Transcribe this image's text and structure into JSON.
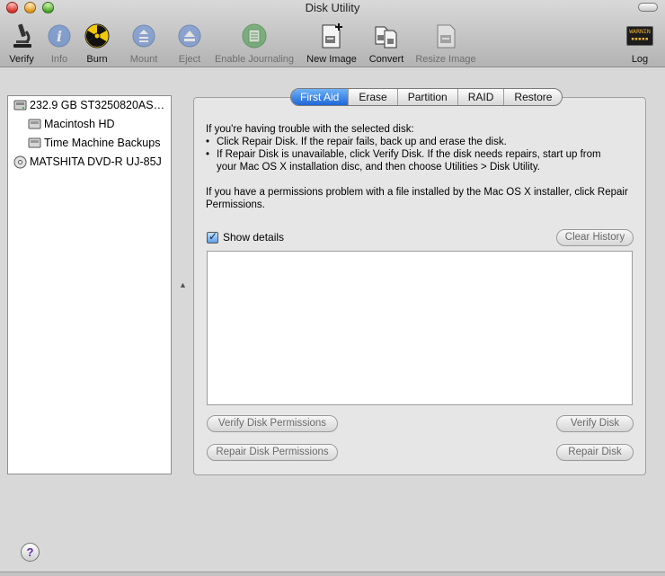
{
  "window": {
    "title": "Disk Utility"
  },
  "toolbar": {
    "items": [
      {
        "label": "Verify",
        "icon": "microscope-icon",
        "enabled": true
      },
      {
        "label": "Info",
        "icon": "info-icon",
        "enabled": false
      },
      {
        "label": "Burn",
        "icon": "burn-radiation-icon",
        "enabled": true
      },
      {
        "label": "Mount",
        "icon": "mount-icon",
        "enabled": false
      },
      {
        "label": "Eject",
        "icon": "eject-icon",
        "enabled": false
      },
      {
        "label": "Enable Journaling",
        "icon": "journaling-icon",
        "enabled": false
      },
      {
        "label": "New Image",
        "icon": "new-image-icon",
        "enabled": true
      },
      {
        "label": "Convert",
        "icon": "convert-icon",
        "enabled": true
      },
      {
        "label": "Resize Image",
        "icon": "resize-image-icon",
        "enabled": false
      },
      {
        "label": "Log",
        "icon": "log-console-icon",
        "enabled": true
      }
    ],
    "log_icon_text": "WARNIN"
  },
  "sidebar": {
    "items": [
      {
        "label": "232.9 GB ST3250820AS…",
        "icon": "hard-drive-icon",
        "indent": 0
      },
      {
        "label": "Macintosh HD",
        "icon": "volume-icon",
        "indent": 1
      },
      {
        "label": "Time Machine Backups",
        "icon": "volume-icon",
        "indent": 1
      },
      {
        "label": "MATSHITA DVD-R UJ-85J",
        "icon": "optical-drive-icon",
        "indent": 0
      }
    ]
  },
  "tabs": [
    {
      "label": "First Aid",
      "active": true
    },
    {
      "label": "Erase",
      "active": false
    },
    {
      "label": "Partition",
      "active": false
    },
    {
      "label": "RAID",
      "active": false
    },
    {
      "label": "Restore",
      "active": false
    }
  ],
  "first_aid": {
    "intro": "If you're having trouble with the selected disk:",
    "bullets": [
      "Click Repair Disk. If the repair fails, back up and erase the disk.",
      "If Repair Disk is unavailable, click Verify Disk. If the disk needs repairs, start up from",
      "your Mac OS X installation disc, and then choose Utilities > Disk Utility."
    ],
    "permissions_text": "If you have a permissions problem with a file installed by the Mac OS X installer, click Repair Permissions.",
    "show_details_label": "Show details",
    "show_details_checked": true,
    "clear_history_label": "Clear History",
    "verify_permissions_label": "Verify Disk Permissions",
    "repair_permissions_label": "Repair Disk Permissions",
    "verify_disk_label": "Verify Disk",
    "repair_disk_label": "Repair Disk"
  },
  "help": {
    "label": "?"
  },
  "colors": {
    "accent": "#2f7de6",
    "window_bg": "#d8d8d8",
    "panel_bg": "#e6e6e6"
  }
}
